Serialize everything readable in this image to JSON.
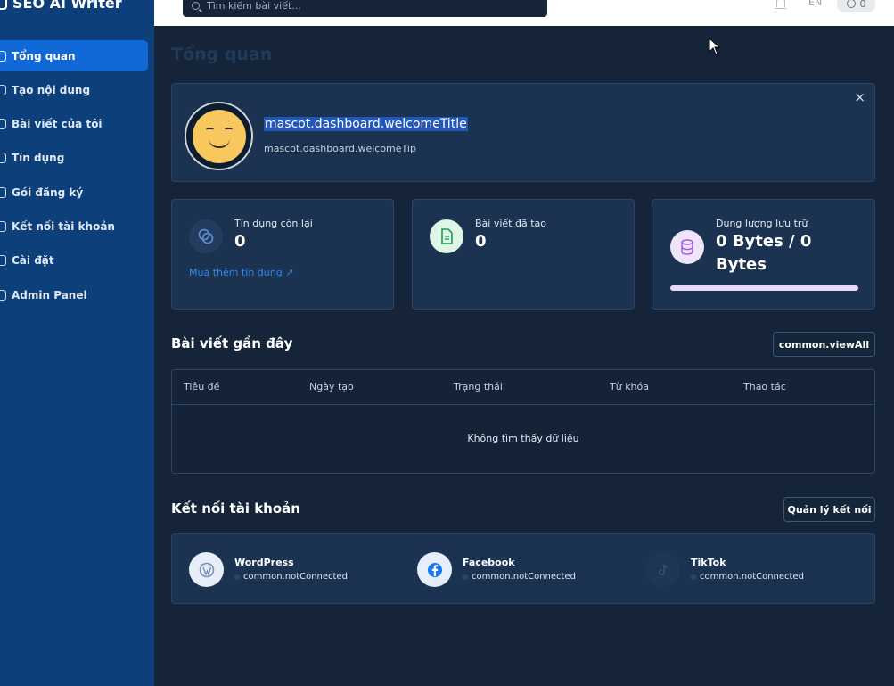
{
  "app": {
    "brand": "SEO AI Writer"
  },
  "sidebar": {
    "items": [
      {
        "label": "Tổng quan",
        "active": true
      },
      {
        "label": "Tạo nội dung",
        "active": false
      },
      {
        "label": "Bài viết của tôi",
        "active": false
      },
      {
        "label": "Tín dụng",
        "active": false
      },
      {
        "label": "Gói đăng ký",
        "active": false
      },
      {
        "label": "Kết nối tài khoản",
        "active": false
      },
      {
        "label": "Cài đặt",
        "active": false
      },
      {
        "label": "Admin Panel",
        "active": false
      }
    ]
  },
  "topbar": {
    "search_placeholder": "Tìm kiếm bài viết...",
    "lang": "EN",
    "credits": "0"
  },
  "page": {
    "title": "Tổng quan"
  },
  "welcome": {
    "title": "mascot.dashboard.welcomeTitle",
    "tip": "mascot.dashboard.welcomeTip",
    "close": "×"
  },
  "stats": {
    "credits": {
      "label": "Tín dụng còn lại",
      "value": "0",
      "link": "Mua thêm tín dụng ↗"
    },
    "articles": {
      "label": "Bài viết đã tạo",
      "value": "0"
    },
    "storage": {
      "label": "Dung lượng lưu trữ",
      "value_line1": "0 Bytes / 0",
      "value_line2": "Bytes",
      "progress_percent": 0
    }
  },
  "recent": {
    "title": "Bài viết gần đây",
    "view_all": "common.viewAll",
    "columns": [
      "Tiêu đề",
      "Ngày tạo",
      "Trạng thái",
      "Từ khóa",
      "Thao tác"
    ],
    "empty": "Không tìm thấy dữ liệu"
  },
  "accounts": {
    "title": "Kết nối tài khoản",
    "manage": "Quản lý kết nối",
    "items": [
      {
        "name": "WordPress",
        "status": "common.notConnected"
      },
      {
        "name": "Facebook",
        "status": "common.notConnected"
      },
      {
        "name": "TikTok",
        "status": "common.notConnected"
      }
    ]
  },
  "colors": {
    "accent": "#1169d8",
    "sidebar": "#0d3f7b",
    "background": "#152438",
    "card": "#1b3250",
    "link": "#2e8bf0"
  }
}
